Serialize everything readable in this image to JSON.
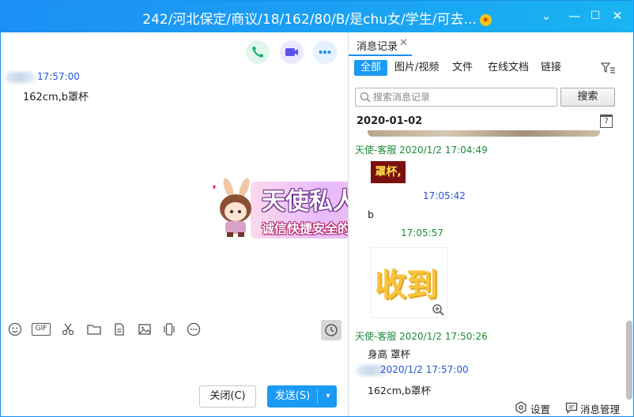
{
  "window": {
    "title": "242/河北保定/商议/18/162/80/B/是chu女/学生/可去...",
    "title_badge": "★",
    "min": "—",
    "max": "☐",
    "close": "✕",
    "menu": "⌄"
  },
  "colors": {
    "accent": "#1a9af2",
    "sender_green": "#1b8a3c",
    "time_blue": "#2255d6"
  },
  "chat": {
    "actions": [
      "phone-icon",
      "video-icon",
      "more-icon"
    ],
    "message": {
      "time": "17:57:00",
      "text": "162cm,b罩杯"
    },
    "sticker": {
      "title": "天使私人订制",
      "subtitle": "诚信快捷安全的交友平台"
    },
    "toolbar": [
      "emoji-icon",
      "gif-icon",
      "scissors-icon",
      "folder-icon",
      "document-icon",
      "image-icon",
      "shake-icon",
      "more-circle-icon"
    ],
    "gif_label": "GIF",
    "close_label": "关闭(C)",
    "send_label": "发送(S)"
  },
  "history": {
    "tab_label": "消息记录",
    "tab_close": "✕",
    "filters": [
      "全部",
      "图片/视频",
      "文件",
      "在线文档",
      "链接"
    ],
    "search_placeholder": "搜索消息记录",
    "search_button": "搜索",
    "date": "2020-01-02",
    "calendar_day": "7",
    "entries": [
      {
        "sender": "天使-客服 2020/1/2 17:04:49"
      },
      {
        "tag": "罩杯,",
        "time": "17:05:42",
        "text": "b"
      },
      {
        "time": "17:05:57"
      },
      {
        "image_text": "收到",
        "sender": "天使-客服 2020/1/2 17:50:26",
        "text": "身高 罩杯"
      },
      {
        "time": "2020/1/2 17:57:00",
        "text": "162cm,b罩杯"
      }
    ],
    "footer": {
      "settings": "设置",
      "manage": "消息管理"
    }
  }
}
